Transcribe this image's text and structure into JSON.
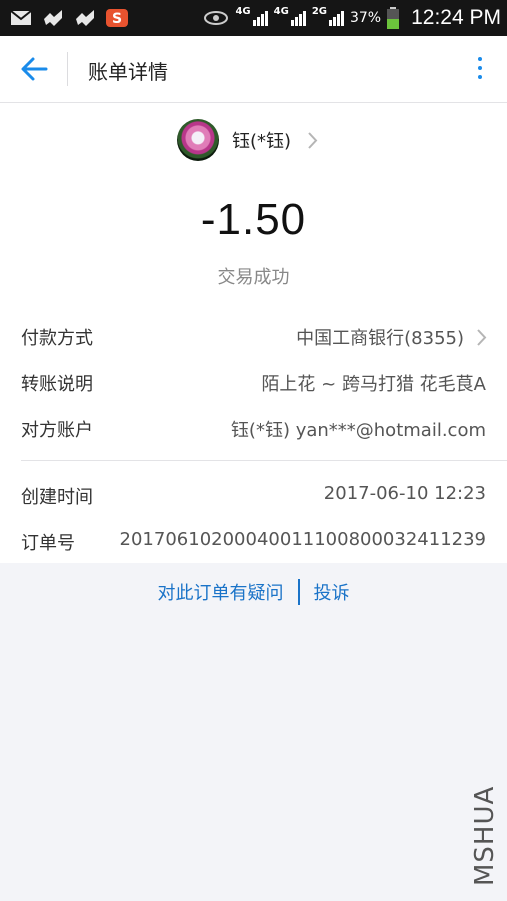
{
  "status_bar": {
    "network1": "4G",
    "network2": "4G",
    "network3": "2G",
    "battery": "37%",
    "time": "12:24 PM"
  },
  "header": {
    "title": "账单详情",
    "back_icon": "arrow-left-icon",
    "more_icon": "more-vertical-icon",
    "accent_color": "#1a8bea"
  },
  "summary": {
    "payee_name": "钰(*钰)",
    "amount": "-1.50",
    "status": "交易成功"
  },
  "details": {
    "rows": [
      {
        "label": "付款方式",
        "value": "中国工商银行(8355)"
      },
      {
        "label": "转账说明",
        "value": "陌上花 ~ 跨马打猎 花毛茛A"
      },
      {
        "label": "对方账户",
        "value": "钰(*钰) yan***@hotmail.com"
      },
      {
        "label": "创建时间",
        "value": "2017-06-10 12:23"
      },
      {
        "label": "订单号",
        "value": "20170610200040011100800032411239"
      }
    ]
  },
  "links": {
    "question": "对此订单有疑问",
    "complain": "投诉"
  },
  "watermark": "MSHUA"
}
